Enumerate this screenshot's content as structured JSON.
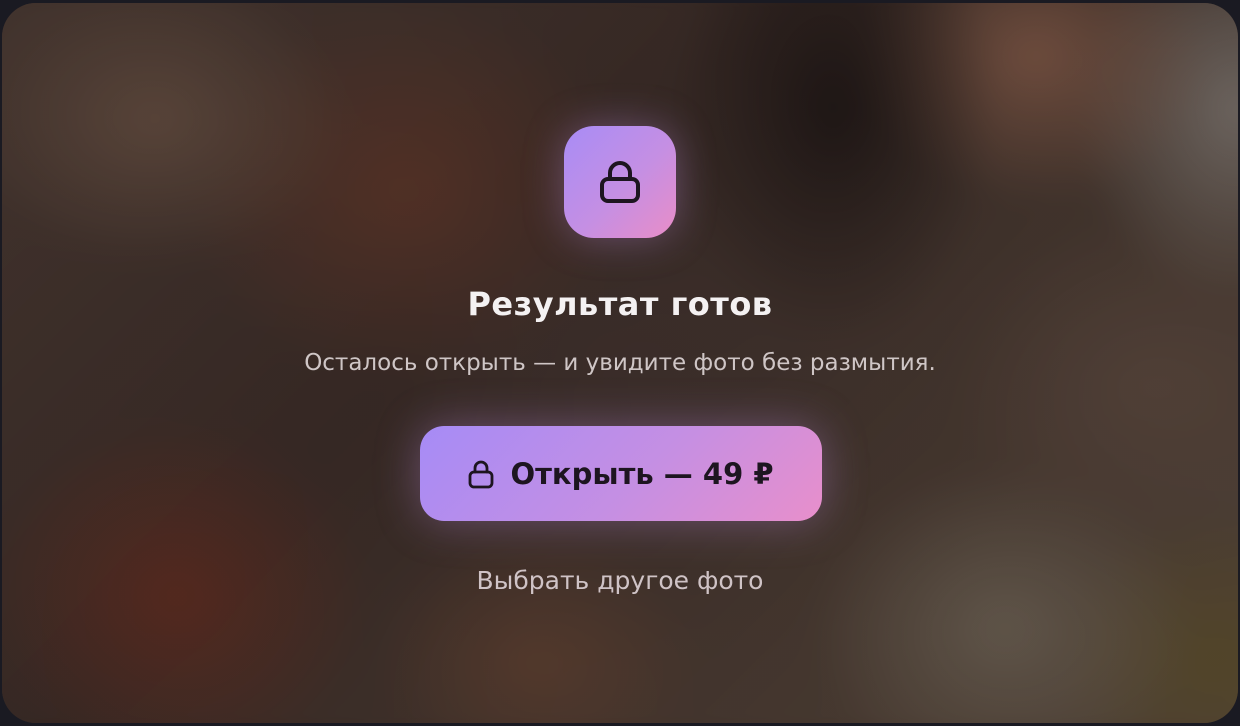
{
  "paywall": {
    "title": "Результат готов",
    "subtitle": "Осталось открыть — и увидите фото без размытия.",
    "cta_label": "Открыть — 49 ₽",
    "secondary_label": "Выбрать другое фото"
  },
  "icons": {
    "tile": "lock-icon",
    "cta": "lock-icon"
  },
  "colors": {
    "accent_start": "#a88cf6",
    "accent_end": "#e98dc7",
    "title_text": "#f4f1f2",
    "subtitle_text": "#cfc6c6",
    "cta_text": "#1d1520"
  }
}
